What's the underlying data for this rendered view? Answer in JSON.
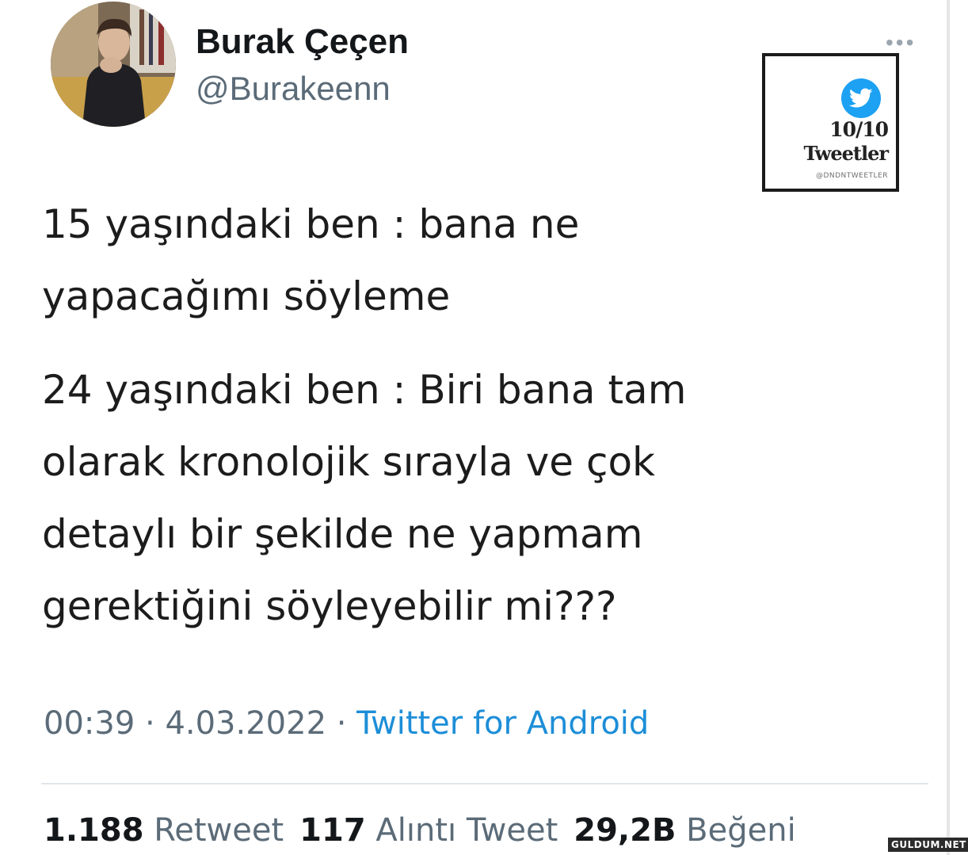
{
  "author": {
    "display_name": "Burak Çeçen",
    "handle": "@Burakeenn"
  },
  "more_menu": "•••",
  "watermark": {
    "icon": "twitter-bird-icon",
    "score": "10/10",
    "title": "Tweetler",
    "handle": "@DNDNTWEETLER"
  },
  "tweet": {
    "paragraph1": [
      "15 yaşındaki ben : bana ne",
      "yapacağımı söyleme"
    ],
    "paragraph2": [
      "24 yaşındaki ben : Biri bana tam",
      "olarak kronolojik sırayla ve çok",
      "detaylı bir şekilde ne yapmam",
      "gerektiğini söyleyebilir mi???"
    ]
  },
  "meta": {
    "time": "00:39",
    "separator": " · ",
    "date": "4.03.2022",
    "source": "Twitter for Android"
  },
  "stats": {
    "retweets_count": "1.188",
    "retweets_label": "Retweet",
    "quotes_count": "117",
    "quotes_label": "Alıntı Tweet",
    "likes_count": "29,2B",
    "likes_label": "Beğeni"
  },
  "site_badge": "GULDUM.NET",
  "colors": {
    "source_link": "#1d8ed8",
    "muted_text": "#5b6b78",
    "twitter_blue": "#1da1f2"
  }
}
